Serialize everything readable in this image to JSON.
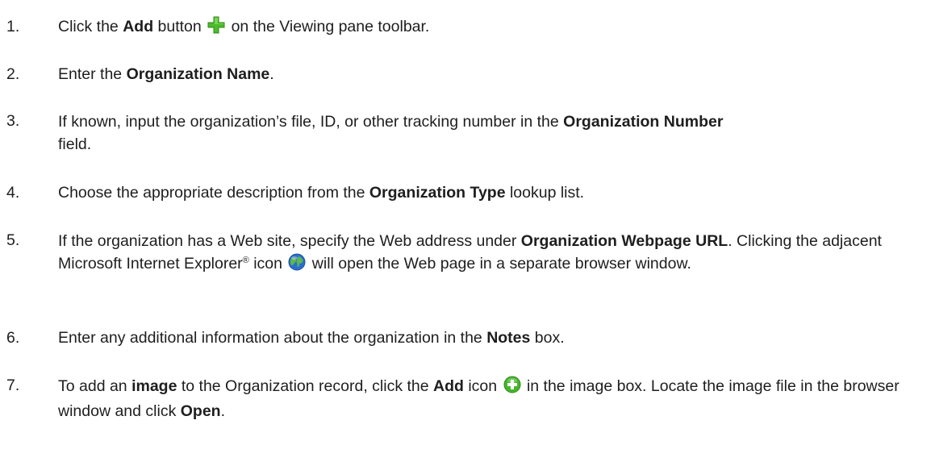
{
  "steps": [
    {
      "number": "1.",
      "parts": [
        {
          "t": "Click the "
        },
        {
          "b": "Add"
        },
        {
          "t": " button "
        },
        {
          "icon": "green-plus-icon"
        },
        {
          "t": " on the Viewing pane toolbar."
        }
      ]
    },
    {
      "number": "2.",
      "parts": [
        {
          "t": "Enter the "
        },
        {
          "b": "Organization Name"
        },
        {
          "t": "."
        }
      ]
    },
    {
      "number": "3.",
      "parts": [
        {
          "t": "If known, input the organization’s file, ID, or other tracking number in the "
        },
        {
          "b": "Organization Number"
        },
        {
          "t": " field."
        }
      ]
    },
    {
      "number": "4.",
      "parts": [
        {
          "t": "Choose the appropriate description from the "
        },
        {
          "b": "Organization Type"
        },
        {
          "t": " lookup list."
        }
      ]
    },
    {
      "number": "5.",
      "parts": [
        {
          "t": "If the organization has a Web site, specify the Web address under "
        },
        {
          "b": "Organization Webpage URL"
        },
        {
          "t": ". Clicking the adjacent Microsoft Internet Explorer"
        },
        {
          "sup": "®"
        },
        {
          "t": " icon "
        },
        {
          "icon": "globe-icon"
        },
        {
          "t": " will open the Web page in a separate browser window."
        }
      ]
    },
    {
      "number": "6.",
      "parts": [
        {
          "t": "Enter any additional information about the organization in the "
        },
        {
          "b": "Notes"
        },
        {
          "t": " box."
        }
      ]
    },
    {
      "number": "7.",
      "parts": [
        {
          "t": "To add an "
        },
        {
          "b": "image"
        },
        {
          "t": " to the Organization record, click the "
        },
        {
          "b": "Add"
        },
        {
          "t": " icon "
        },
        {
          "icon": "green-circle-plus-icon"
        },
        {
          "t": " in the image box. Locate the image file in the browser window and click "
        },
        {
          "b": "Open"
        },
        {
          "t": "."
        }
      ]
    }
  ]
}
